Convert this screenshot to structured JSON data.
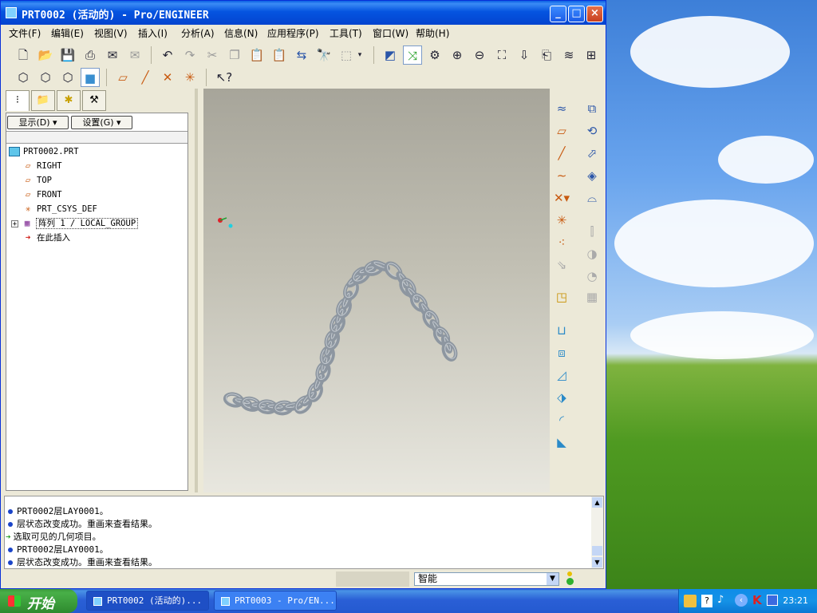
{
  "window": {
    "title": "PRT0002 (活动的) - Pro/ENGINEER",
    "minimize": "_",
    "maximize": "□",
    "close": "×"
  },
  "menu": [
    "文件(F)",
    "编辑(E)",
    "视图(V)",
    "插入(I)",
    "分析(A)",
    "信息(N)",
    "应用程序(P)",
    "工具(T)",
    "窗口(W)",
    "帮助(H)"
  ],
  "tree_panel": {
    "show_button": "显示(D) ▾",
    "settings_button": "设置(G) ▾",
    "nodes": [
      {
        "label": "PRT0002.PRT",
        "icon": "part-icon"
      },
      {
        "label": "RIGHT",
        "icon": "datum-plane-icon"
      },
      {
        "label": "TOP",
        "icon": "datum-plane-icon"
      },
      {
        "label": "FRONT",
        "icon": "datum-plane-icon"
      },
      {
        "label": "PRT_CSYS_DEF",
        "icon": "csys-icon"
      },
      {
        "label": "阵列 1 / LOCAL_GROUP",
        "icon": "pattern-icon"
      },
      {
        "label": "在此插入",
        "icon": "insert-arrow-icon"
      }
    ]
  },
  "messages": [
    {
      "type": "info",
      "text": "PRT0002层LAY0001。"
    },
    {
      "type": "info",
      "text": "层状态改变成功。重画来查看结果。"
    },
    {
      "type": "prompt",
      "text": "选取可见的几何项目。"
    },
    {
      "type": "info",
      "text": "PRT0002层LAY0001。"
    },
    {
      "type": "info",
      "text": "层状态改变成功。重画来查看结果。"
    }
  ],
  "status": {
    "filter_value": "智能"
  },
  "taskbar": {
    "start_label": "开始",
    "tasks": [
      "PRT0002 (活动的)...",
      "PRT0003 - Pro/EN..."
    ],
    "clock": "23:21"
  },
  "colors": {
    "titlebar": "#0554e0",
    "chrome": "#ece9d8",
    "chain": "#8d96a0"
  }
}
